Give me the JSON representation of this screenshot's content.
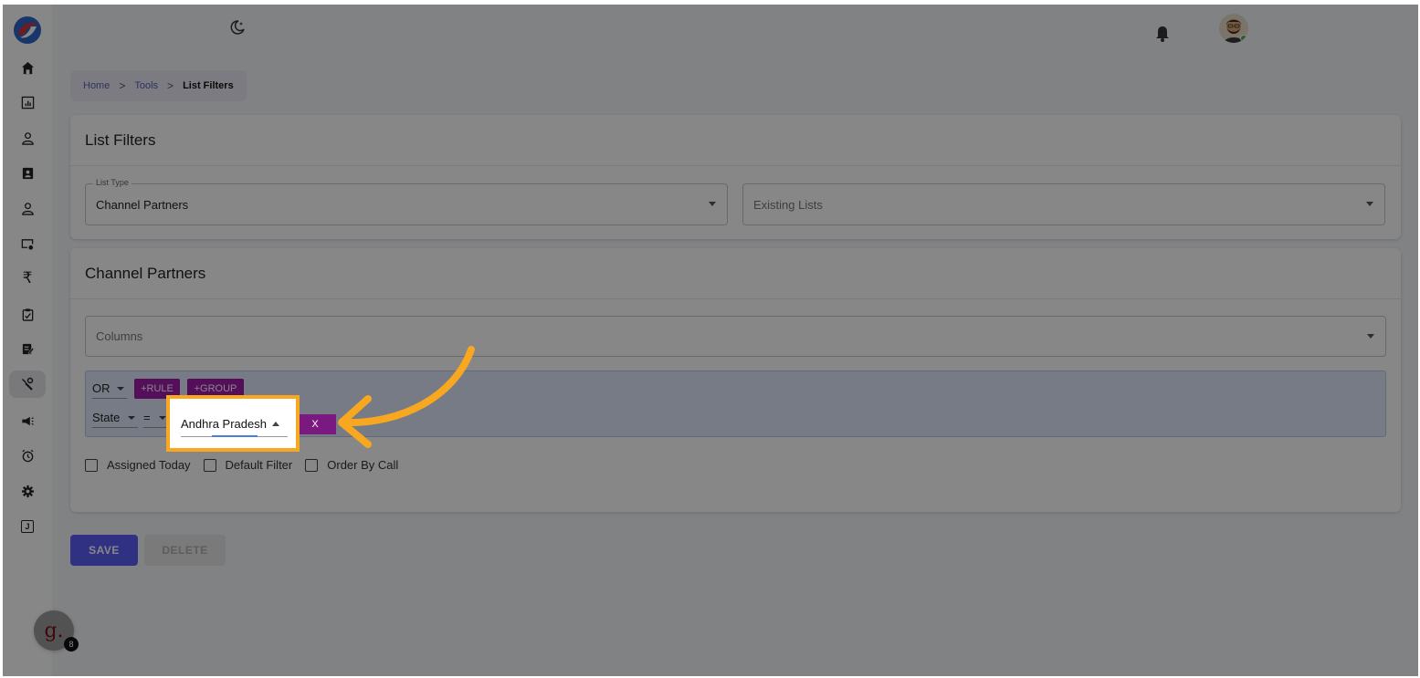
{
  "sidebar": {
    "items": [
      {
        "icon": "home-icon"
      },
      {
        "icon": "dashboard-icon"
      },
      {
        "icon": "user-icon"
      },
      {
        "icon": "contact-card-icon"
      },
      {
        "icon": "person-icon"
      },
      {
        "icon": "monitor-settings-icon"
      },
      {
        "icon": "rupee-icon",
        "glyph": "₹"
      },
      {
        "icon": "clipboard-check-icon"
      },
      {
        "icon": "edit-document-icon"
      },
      {
        "icon": "tools-icon",
        "active": true
      },
      {
        "icon": "megaphone-icon"
      },
      {
        "icon": "alarm-clock-icon"
      },
      {
        "icon": "gear-icon"
      },
      {
        "icon": "j-square-icon",
        "glyph": "J"
      }
    ]
  },
  "breadcrumb": {
    "home": "Home",
    "tools": "Tools",
    "current": "List Filters",
    "separator": ">"
  },
  "list_filters_card": {
    "title": "List Filters",
    "list_type_label": "List Type",
    "list_type_value": "Channel Partners",
    "existing_lists_placeholder": "Existing Lists"
  },
  "partners_card": {
    "title": "Channel Partners",
    "columns_placeholder": "Columns",
    "query": {
      "combinator": "OR",
      "add_rule": "+RULE",
      "add_group": "+GROUP",
      "field": "State",
      "operator": "=",
      "value": "Andhra Pradesh",
      "remove": "X"
    },
    "checkboxes": [
      "Assigned Today",
      "Default Filter",
      "Order By Call"
    ]
  },
  "actions": {
    "save": "SAVE",
    "delete": "DELETE"
  },
  "chat_widget": {
    "letter": "g.",
    "badge": "8"
  },
  "colors": {
    "accent": "#5b5ef5",
    "query_button": "#a11ba8",
    "highlight": "#f7a820"
  }
}
